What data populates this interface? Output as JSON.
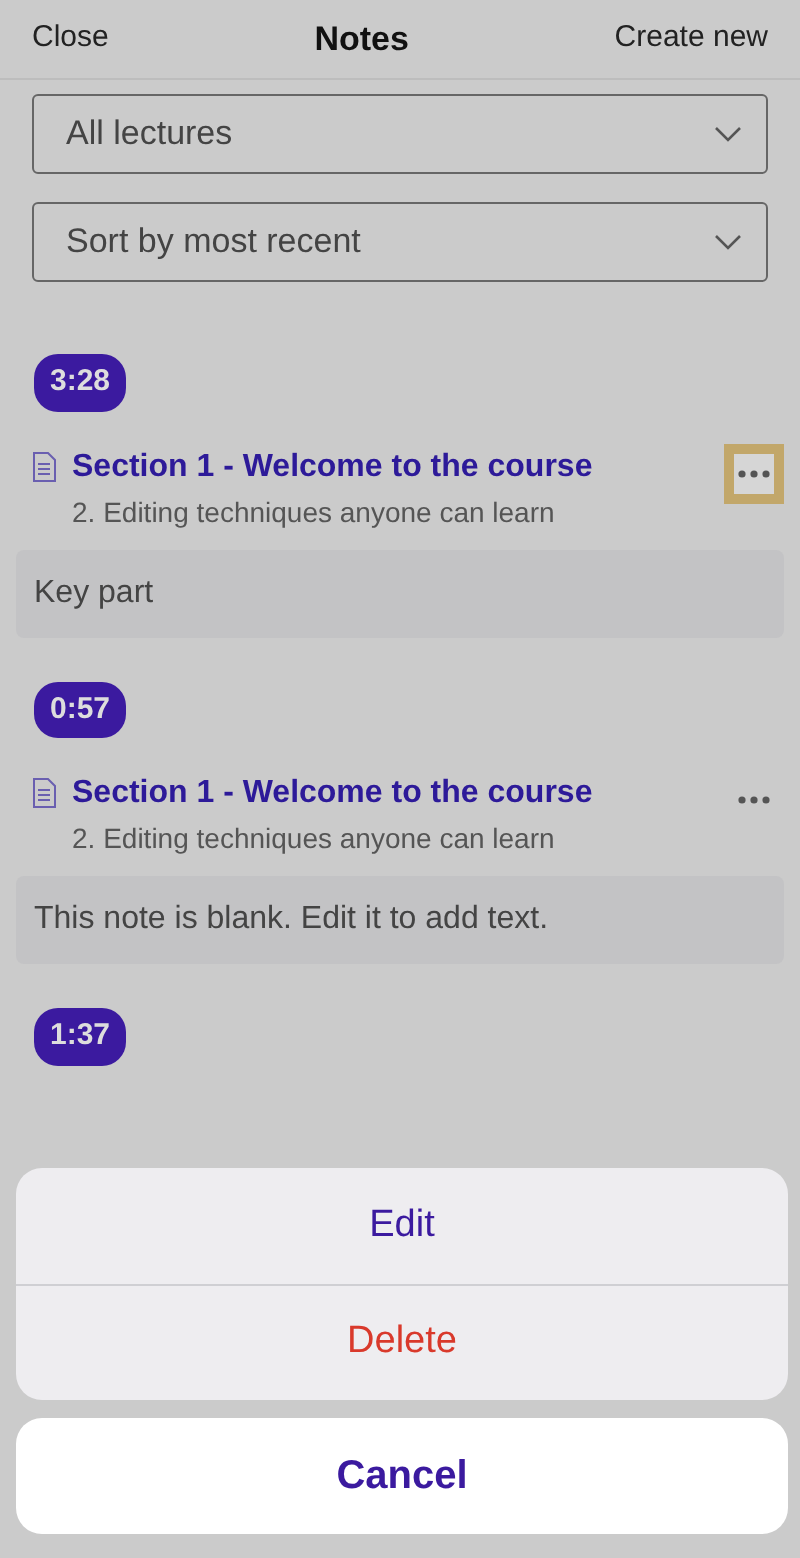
{
  "header": {
    "close": "Close",
    "title": "Notes",
    "create": "Create new"
  },
  "filters": [
    {
      "value": "All lectures"
    },
    {
      "value": "Sort by most recent"
    }
  ],
  "notes": [
    {
      "time": "3:28",
      "title": "Section 1 - Welcome to the course",
      "lecture": "2. Editing techniques anyone can learn",
      "body": "Key part",
      "menu_selected": true
    },
    {
      "time": "0:57",
      "title": "Section 1 - Welcome to the course",
      "lecture": "2. Editing techniques anyone can learn",
      "body": "This note is blank. Edit it to add text.",
      "menu_selected": false
    },
    {
      "time": "1:37"
    }
  ],
  "action_sheet": {
    "actions": [
      {
        "label": "Edit",
        "kind": "default"
      },
      {
        "label": "Delete",
        "kind": "destructive"
      }
    ],
    "cancel": "Cancel"
  }
}
